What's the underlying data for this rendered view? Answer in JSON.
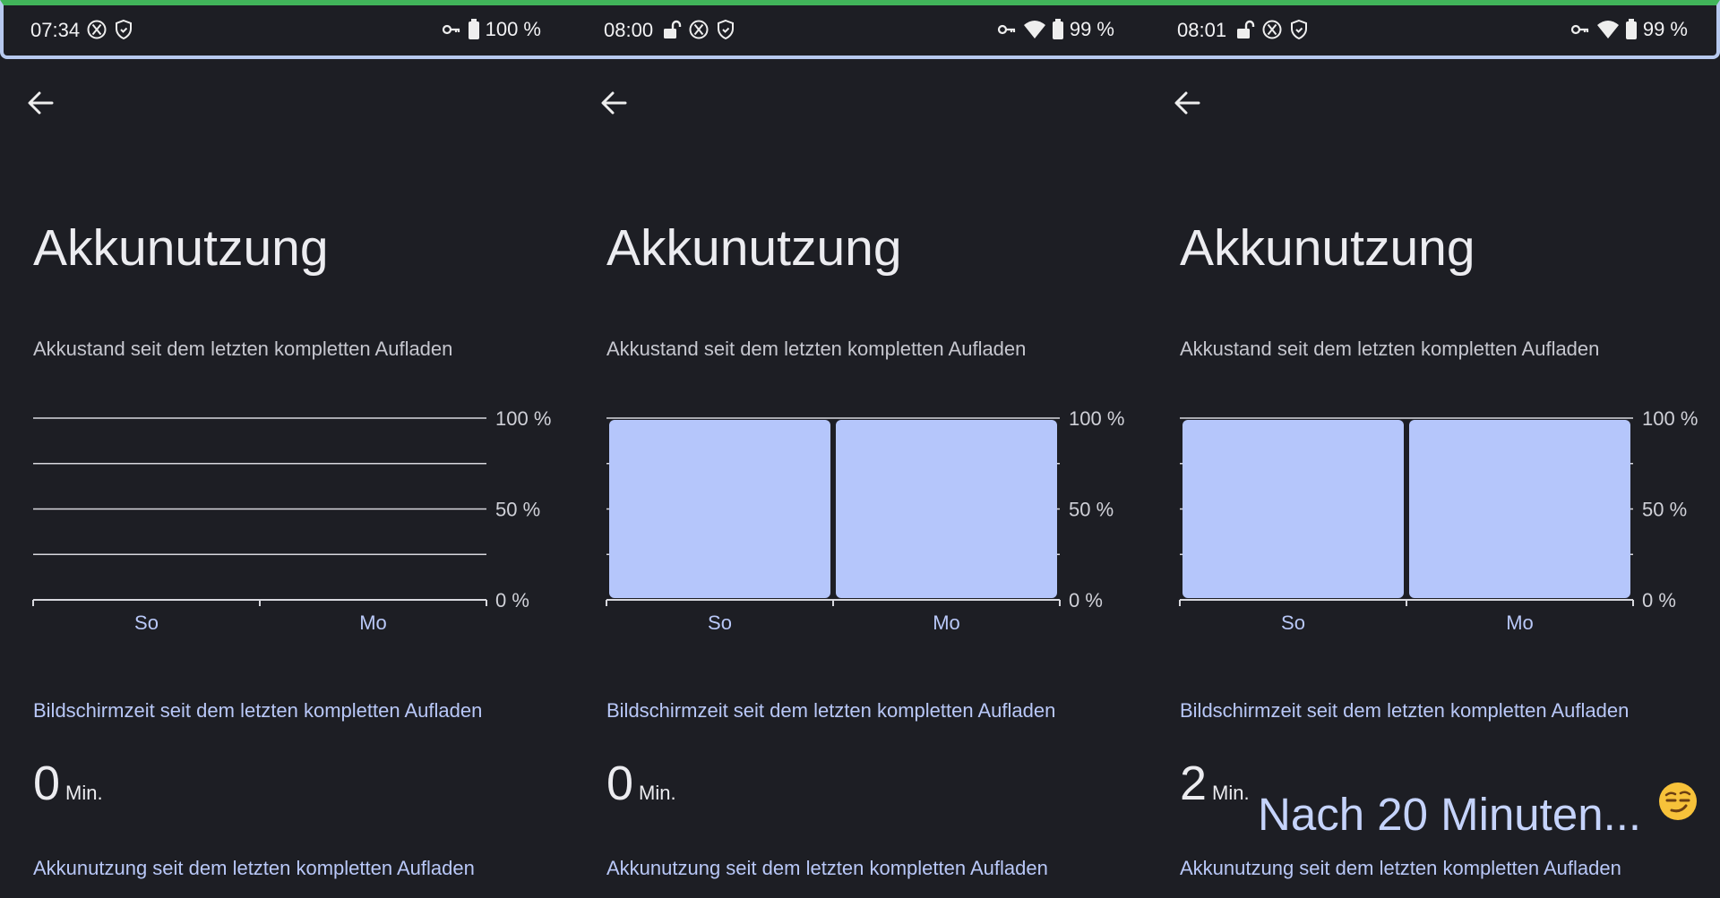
{
  "panels": [
    {
      "status": {
        "time": "07:34",
        "battery_pct": "100 %",
        "icons_left": [
          "x-icon",
          "shield-icon"
        ],
        "icons_right": [
          "key-icon",
          "battery-icon"
        ]
      },
      "title": "Akkunutzung",
      "subtitle": "Akkustand seit dem letzten kompletten Aufladen",
      "screen_time_heading": "Bildschirmzeit seit dem letzten kompletten Aufladen",
      "screen_time_value": "0",
      "screen_time_unit": "Min.",
      "usage_heading": "Akkunutzung seit dem letzten kompletten Aufladen"
    },
    {
      "status": {
        "time": "08:00",
        "battery_pct": "99 %",
        "icons_left": [
          "unlock-icon",
          "x-icon",
          "shield-icon"
        ],
        "icons_right": [
          "key-icon",
          "wifi-icon",
          "battery-icon"
        ]
      },
      "title": "Akkunutzung",
      "subtitle": "Akkustand seit dem letzten kompletten Aufladen",
      "screen_time_heading": "Bildschirmzeit seit dem letzten kompletten Aufladen",
      "screen_time_value": "0",
      "screen_time_unit": "Min.",
      "usage_heading": "Akkunutzung seit dem letzten kompletten Aufladen"
    },
    {
      "status": {
        "time": "08:01",
        "battery_pct": "99 %",
        "icons_left": [
          "unlock-icon",
          "x-icon",
          "shield-icon"
        ],
        "icons_right": [
          "key-icon",
          "wifi-icon",
          "battery-icon"
        ]
      },
      "title": "Akkunutzung",
      "subtitle": "Akkustand seit dem letzten kompletten Aufladen",
      "screen_time_heading": "Bildschirmzeit seit dem letzten kompletten Aufladen",
      "screen_time_value": "2",
      "screen_time_unit": "Min.",
      "usage_heading": "Akkunutzung seit dem letzten kompletten Aufladen"
    }
  ],
  "overlay_caption": "Nach 20 Minuten...",
  "overlay_emoji": "smirk-emoji",
  "colors": {
    "background": "#1d1e24",
    "bar": "#b5c6fb",
    "accent_text": "#b9c8f8",
    "status_frame_top": "#41b45a",
    "status_frame": "#b7c9ef"
  },
  "chart_data": [
    {
      "type": "bar",
      "categories": [
        "So",
        "Mo"
      ],
      "values": [],
      "y_ticks": [
        "100 %",
        "50 %",
        "0 %"
      ],
      "ylim": [
        0,
        100
      ],
      "grid": true
    },
    {
      "type": "bar",
      "categories": [
        "So",
        "Mo"
      ],
      "values": [
        99,
        99
      ],
      "y_ticks": [
        "100 %",
        "50 %",
        "0 %"
      ],
      "ylim": [
        0,
        100
      ],
      "grid": true
    },
    {
      "type": "bar",
      "categories": [
        "So",
        "Mo"
      ],
      "values": [
        99,
        99
      ],
      "y_ticks": [
        "100 %",
        "50 %",
        "0 %"
      ],
      "ylim": [
        0,
        100
      ],
      "grid": true
    }
  ]
}
